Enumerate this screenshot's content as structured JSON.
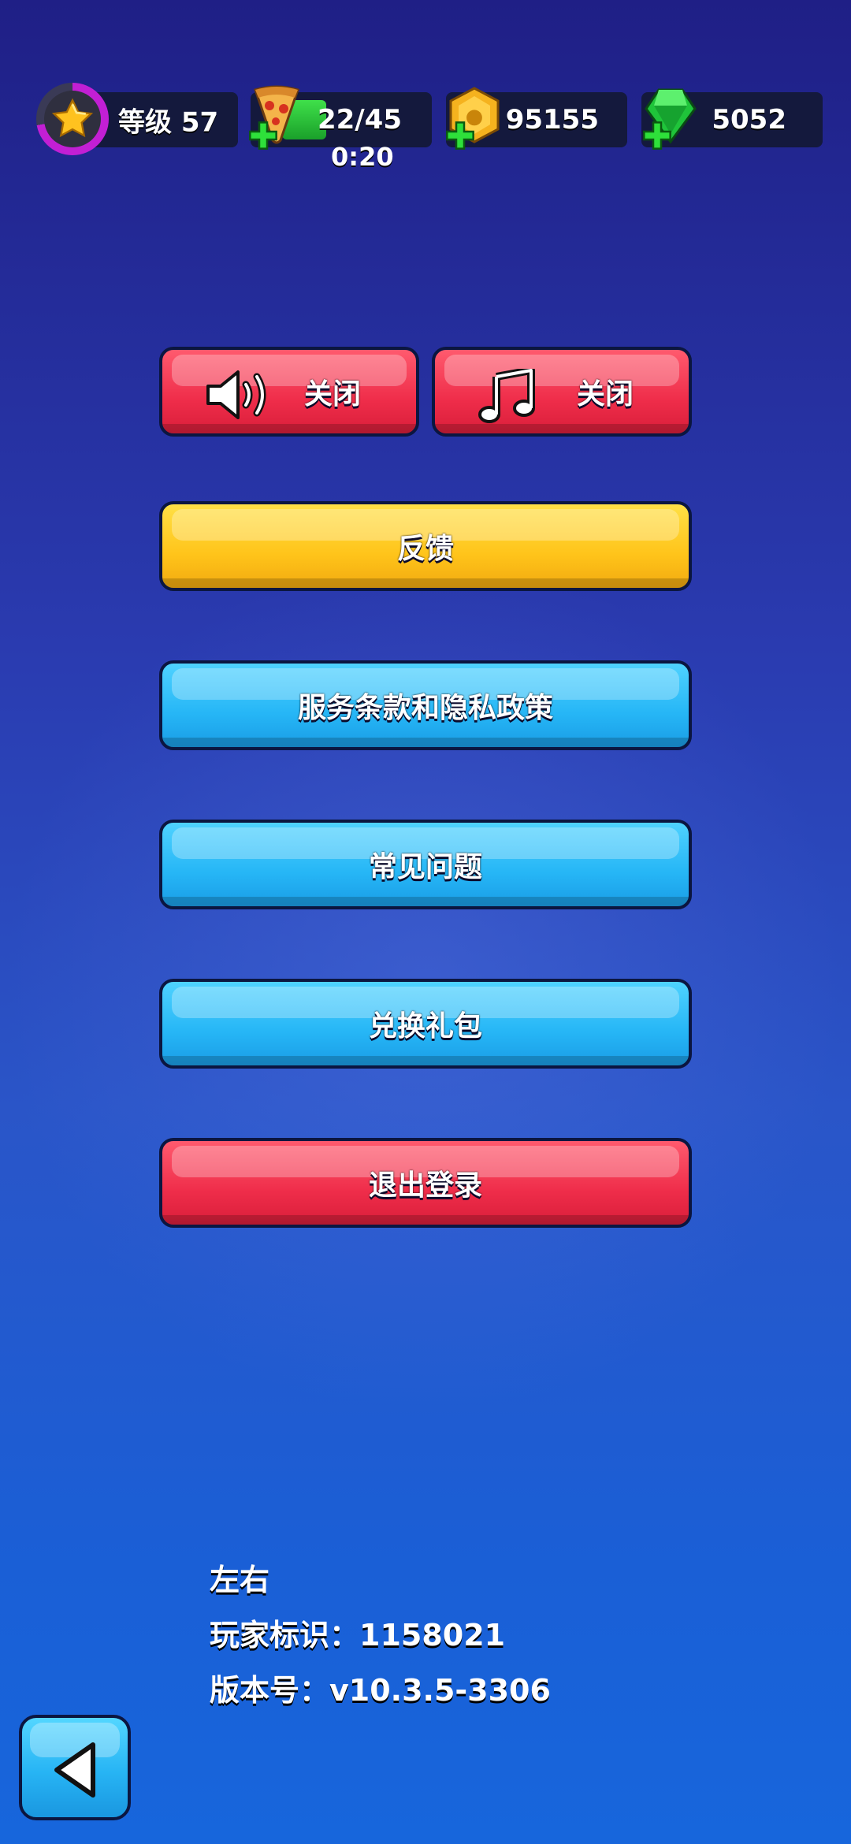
{
  "topbar": {
    "level": {
      "label": "等级 57",
      "progress": 0.72
    },
    "energy": {
      "value": "22/45",
      "timer": "0:20",
      "fill": 0.49
    },
    "coins": {
      "value": "95155"
    },
    "gems": {
      "value": "5052"
    }
  },
  "settings": {
    "sound_label": "关闭",
    "music_label": "关闭",
    "feedback_label": "反馈",
    "terms_label": "服务条款和隐私政策",
    "faq_label": "常见问题",
    "redeem_label": "兑换礼包",
    "logout_label": "退出登录"
  },
  "player": {
    "name": "左右",
    "id_line": "玩家标识：1158021",
    "version_line": "版本号：v10.3.5-3306"
  },
  "colors": {
    "red": "#ef2d4a",
    "yellow": "#ffc41a",
    "blue": "#26b6f6",
    "pill_bg": "#14193d"
  },
  "icons": [
    "star-icon",
    "pizza-icon",
    "coin-icon",
    "gem-icon",
    "plus-icon",
    "speaker-icon",
    "music-note-icon",
    "back-arrow-icon"
  ]
}
